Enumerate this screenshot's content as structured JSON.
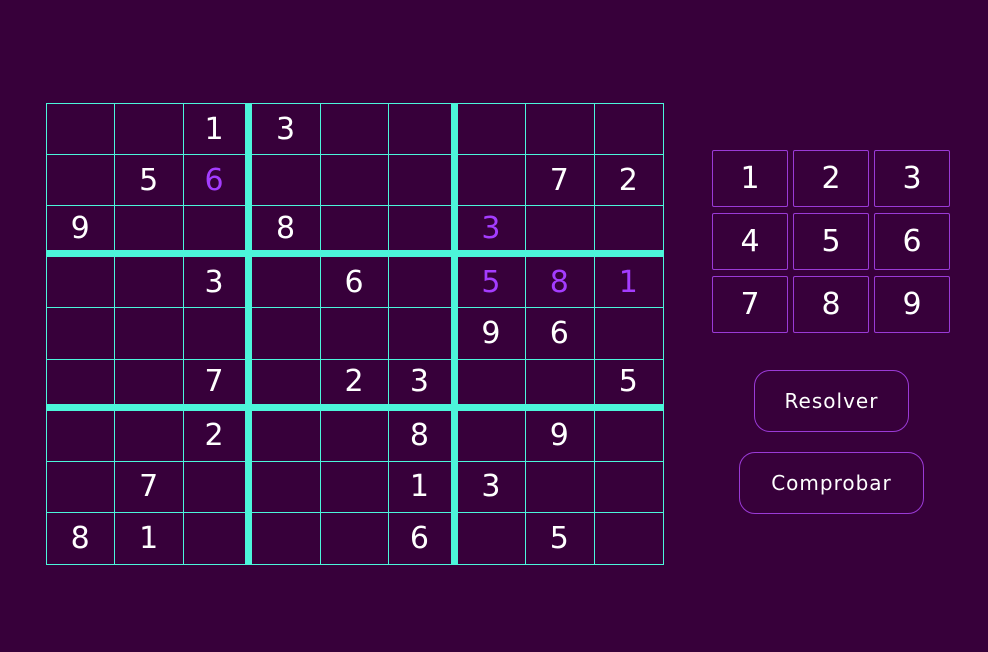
{
  "colors": {
    "background": "#37003a",
    "grid": "#4cf5da",
    "given_digit": "#ffffff",
    "user_digit": "#a43cff",
    "button_border": "#9a3ad6"
  },
  "board": {
    "rows": [
      [
        {
          "v": ""
        },
        {
          "v": ""
        },
        {
          "v": "1"
        },
        {
          "v": "3"
        },
        {
          "v": ""
        },
        {
          "v": ""
        },
        {
          "v": ""
        },
        {
          "v": ""
        },
        {
          "v": ""
        }
      ],
      [
        {
          "v": ""
        },
        {
          "v": "5"
        },
        {
          "v": "6",
          "user": true
        },
        {
          "v": ""
        },
        {
          "v": ""
        },
        {
          "v": ""
        },
        {
          "v": ""
        },
        {
          "v": "7"
        },
        {
          "v": "2"
        }
      ],
      [
        {
          "v": "9"
        },
        {
          "v": ""
        },
        {
          "v": ""
        },
        {
          "v": "8"
        },
        {
          "v": ""
        },
        {
          "v": ""
        },
        {
          "v": "3",
          "user": true
        },
        {
          "v": ""
        },
        {
          "v": ""
        }
      ],
      [
        {
          "v": ""
        },
        {
          "v": ""
        },
        {
          "v": "3"
        },
        {
          "v": ""
        },
        {
          "v": "6"
        },
        {
          "v": ""
        },
        {
          "v": "5",
          "user": true
        },
        {
          "v": "8",
          "user": true
        },
        {
          "v": "1",
          "user": true
        }
      ],
      [
        {
          "v": ""
        },
        {
          "v": ""
        },
        {
          "v": ""
        },
        {
          "v": ""
        },
        {
          "v": ""
        },
        {
          "v": ""
        },
        {
          "v": "9"
        },
        {
          "v": "6"
        },
        {
          "v": ""
        }
      ],
      [
        {
          "v": ""
        },
        {
          "v": ""
        },
        {
          "v": "7"
        },
        {
          "v": ""
        },
        {
          "v": "2"
        },
        {
          "v": "3"
        },
        {
          "v": ""
        },
        {
          "v": ""
        },
        {
          "v": "5"
        }
      ],
      [
        {
          "v": ""
        },
        {
          "v": ""
        },
        {
          "v": "2"
        },
        {
          "v": ""
        },
        {
          "v": ""
        },
        {
          "v": "8"
        },
        {
          "v": ""
        },
        {
          "v": "9"
        },
        {
          "v": ""
        }
      ],
      [
        {
          "v": ""
        },
        {
          "v": "7"
        },
        {
          "v": ""
        },
        {
          "v": ""
        },
        {
          "v": ""
        },
        {
          "v": "1"
        },
        {
          "v": "3"
        },
        {
          "v": ""
        },
        {
          "v": ""
        }
      ],
      [
        {
          "v": "8"
        },
        {
          "v": "1"
        },
        {
          "v": ""
        },
        {
          "v": ""
        },
        {
          "v": ""
        },
        {
          "v": "6"
        },
        {
          "v": ""
        },
        {
          "v": "5"
        },
        {
          "v": ""
        }
      ]
    ]
  },
  "numpad": [
    "1",
    "2",
    "3",
    "4",
    "5",
    "6",
    "7",
    "8",
    "9"
  ],
  "actions": {
    "resolver_label": "Resolver",
    "comprobar_label": "Comprobar"
  }
}
